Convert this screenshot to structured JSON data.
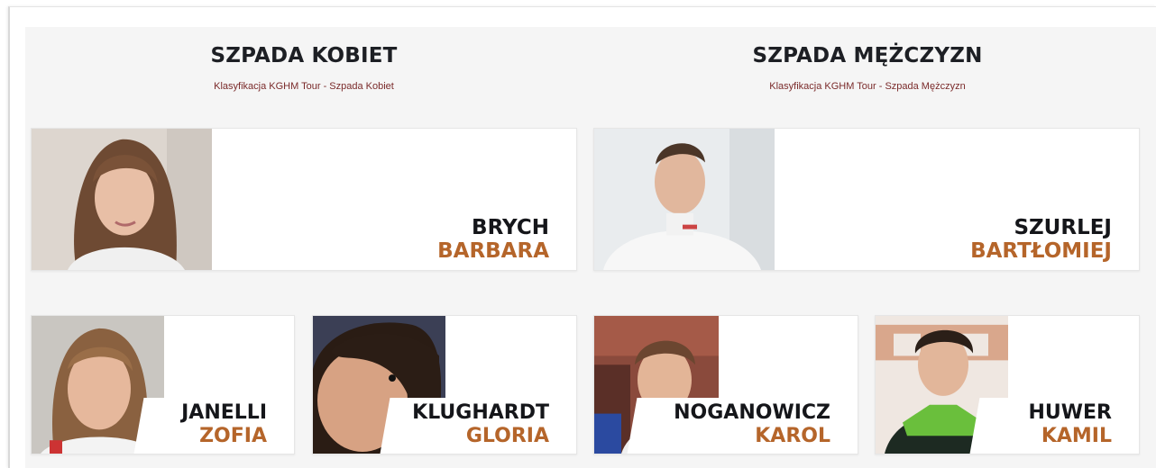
{
  "sections": [
    {
      "title": "SZPADA KOBIET",
      "subtitle": "Klasyfikacja KGHM Tour - Szpada Kobiet",
      "athletes": [
        {
          "last": "BRYCH",
          "first": "BARBARA"
        },
        {
          "last": "JANELLI",
          "first": "ZOFIA"
        },
        {
          "last": "KLUGHARDT",
          "first": "GLORIA"
        }
      ]
    },
    {
      "title": "SZPADA MĘŻCZYZN",
      "subtitle": "Klasyfikacja KGHM Tour - Szpada Mężczyzn",
      "athletes": [
        {
          "last": "SZURLEJ",
          "first": "BARTŁOMIEJ"
        },
        {
          "last": "NOGANOWICZ",
          "first": "KAROL"
        },
        {
          "last": "HUWER",
          "first": "KAMIL"
        }
      ]
    }
  ],
  "colors": {
    "first_name": "#b5652a",
    "last_name": "#15161a",
    "subtitle": "#7a2a2a",
    "panel": "#f5f5f5"
  },
  "icons": [
    "athlete-photo"
  ]
}
